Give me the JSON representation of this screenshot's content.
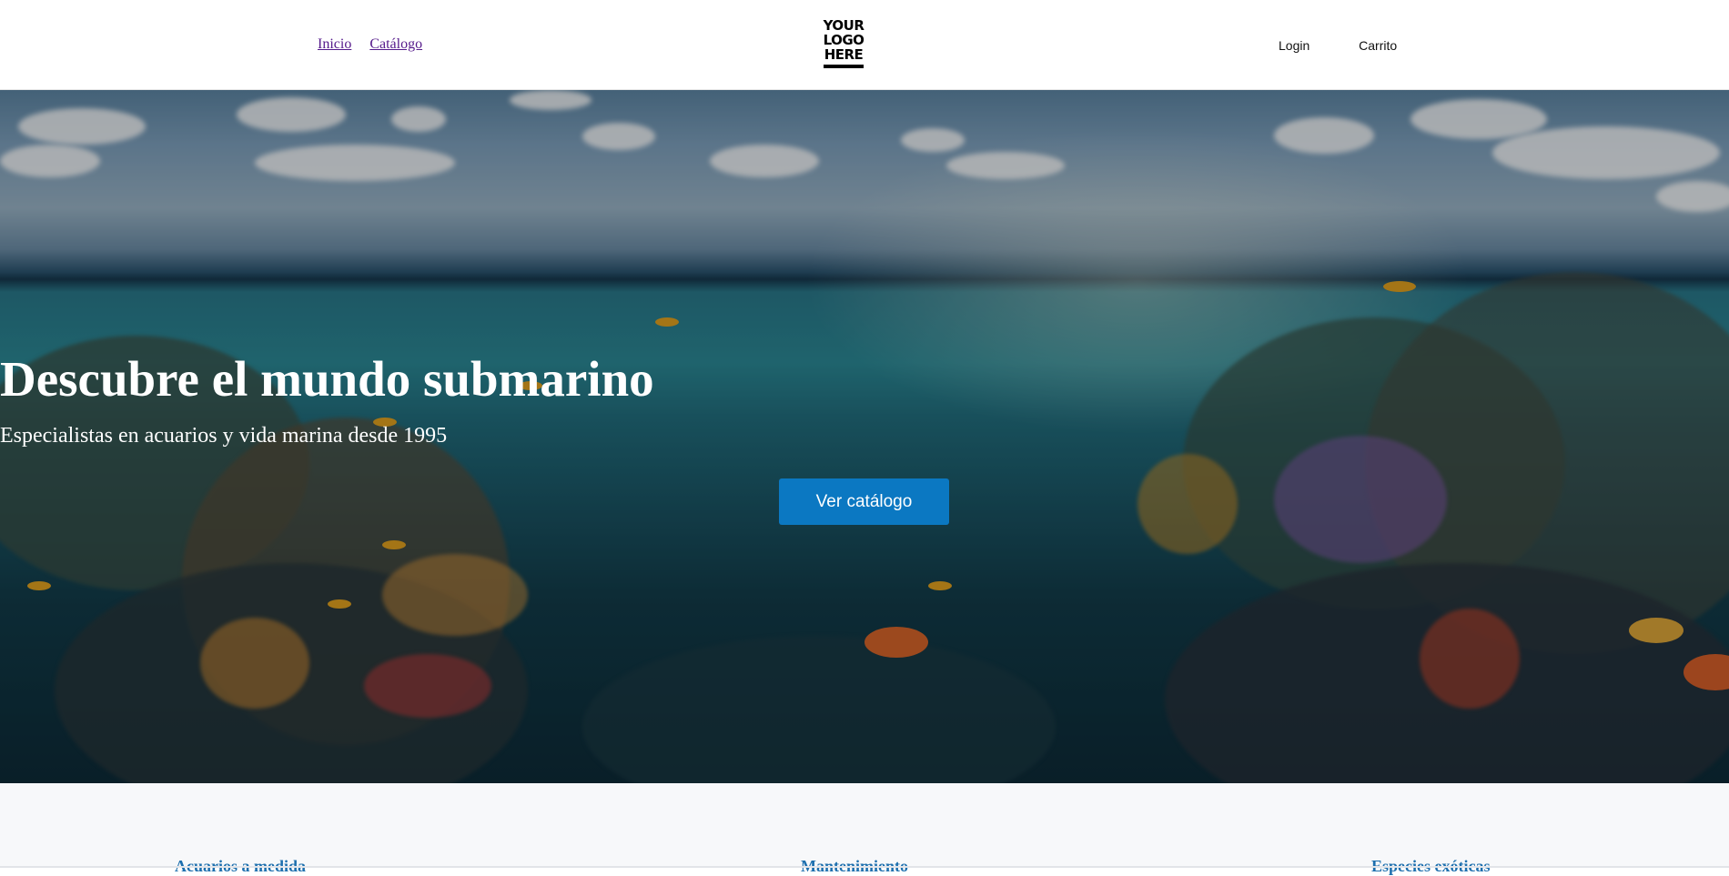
{
  "header": {
    "nav_left": [
      {
        "label": "Inicio"
      },
      {
        "label": "Catálogo"
      }
    ],
    "logo_text": "YOUR\nLOGO\nHERE",
    "nav_right": {
      "login": "Login",
      "cart": "Carrito"
    }
  },
  "hero": {
    "title": "Descubre el mundo submarino",
    "subtitle": "Especialistas en acuarios y vida marina desde 1995",
    "cta_label": "Ver catálogo"
  },
  "services": [
    {
      "title": "Acuarios a medida"
    },
    {
      "title": "Mantenimiento"
    },
    {
      "title": "Especies exóticas"
    }
  ],
  "colors": {
    "accent": "#0b78c2",
    "link_visited": "#551a8b",
    "service_title": "#1d6fae",
    "services_bg": "#f7f8fa"
  }
}
